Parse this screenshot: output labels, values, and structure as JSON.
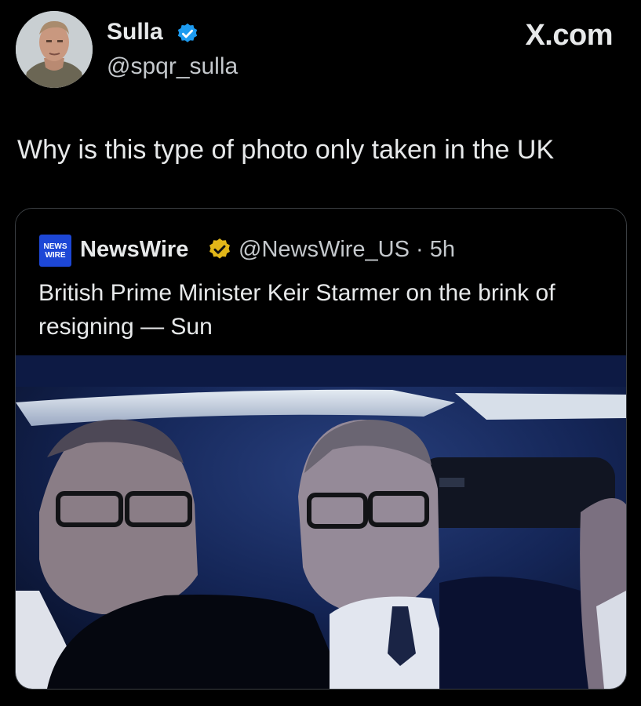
{
  "author": {
    "display_name": "Sulla",
    "handle": "@spqr_sulla"
  },
  "watermark": "X.com",
  "tweet_text": "Why is this type of photo only taken in the UK",
  "quote": {
    "logo_text_top": "NEWS",
    "logo_text_bottom": "WIRE",
    "name": "NewsWire",
    "handle_time": "@NewsWire_US · 5h",
    "text": "British Prime Minister Keir Starmer on the brink of resigning — Sun"
  },
  "colors": {
    "background": "#000000",
    "verified_blue": "#1d9bf0",
    "verified_gold": "#e2b719",
    "logo_blue": "#1d47d6"
  },
  "icons": {
    "verified": "verified-badge-icon",
    "gold_verified": "gold-verified-badge-icon"
  }
}
